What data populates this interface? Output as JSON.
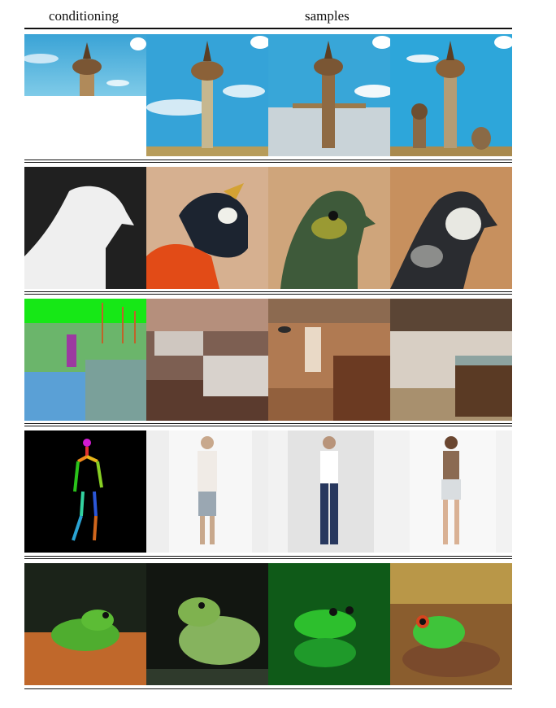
{
  "header": {
    "conditioning_label": "conditioning",
    "samples_label": "samples"
  },
  "rows": [
    {
      "conditioning": "partial-image-tower",
      "samples": [
        "tower-sample-1",
        "tower-sample-2",
        "tower-sample-3"
      ]
    },
    {
      "conditioning": "depth-map-bird",
      "samples": [
        "bird-sample-1",
        "bird-sample-2",
        "bird-sample-3"
      ]
    },
    {
      "conditioning": "segmentation-map-interior",
      "samples": [
        "interior-sample-1",
        "interior-sample-2",
        "interior-sample-3"
      ]
    },
    {
      "conditioning": "pose-skeleton",
      "samples": [
        "fashion-sample-1",
        "fashion-sample-2",
        "fashion-sample-3"
      ]
    },
    {
      "conditioning": "frog-photo",
      "samples": [
        "frog-sample-1",
        "frog-sample-2",
        "frog-sample-3"
      ]
    }
  ]
}
